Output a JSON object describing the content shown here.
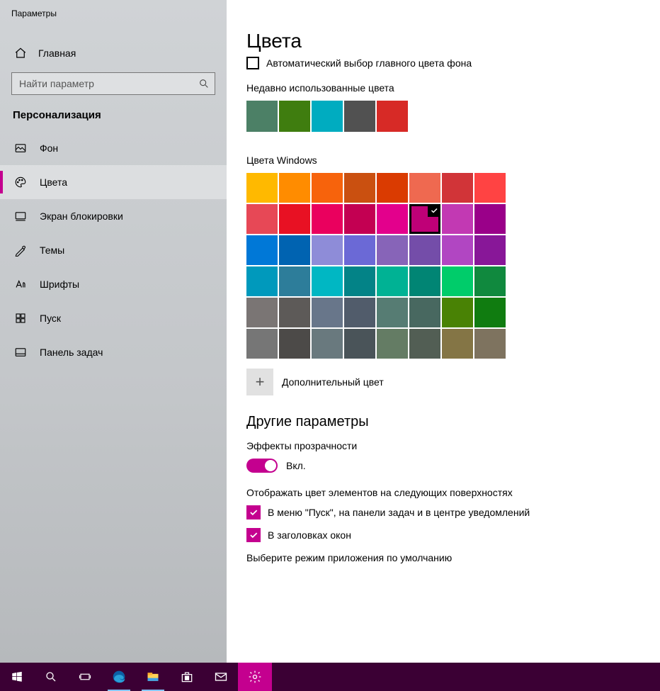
{
  "windowTitle": "Параметры",
  "sidebar": {
    "home": "Главная",
    "searchPlaceholder": "Найти параметр",
    "category": "Персонализация",
    "items": [
      {
        "key": "background",
        "label": "Фон"
      },
      {
        "key": "colors",
        "label": "Цвета"
      },
      {
        "key": "lockscreen",
        "label": "Экран блокировки"
      },
      {
        "key": "themes",
        "label": "Темы"
      },
      {
        "key": "fonts",
        "label": "Шрифты"
      },
      {
        "key": "start",
        "label": "Пуск"
      },
      {
        "key": "taskbar",
        "label": "Панель задач"
      }
    ],
    "activeKey": "colors"
  },
  "content": {
    "title": "Цвета",
    "autoPick": {
      "label": "Автоматический выбор главного цвета фона",
      "checked": false
    },
    "recent": {
      "label": "Недавно использованные цвета",
      "colors": [
        "#4c8066",
        "#3f7d0f",
        "#00acc0",
        "#515151",
        "#d72a26"
      ]
    },
    "windowsColors": {
      "label": "Цвета Windows",
      "colors": [
        "#ffb900",
        "#ff8c00",
        "#f7630c",
        "#ca5010",
        "#da3b01",
        "#ef6950",
        "#d13438",
        "#ff4343",
        "#e74856",
        "#e81123",
        "#ea005e",
        "#c30052",
        "#e3008c",
        "#bf0077",
        "#c239b3",
        "#9a0089",
        "#0078d7",
        "#0063b1",
        "#8e8cd8",
        "#6b69d6",
        "#8764b8",
        "#744da9",
        "#b146c2",
        "#881798",
        "#0099bc",
        "#2d7d9a",
        "#00b7c3",
        "#038387",
        "#00b294",
        "#018574",
        "#00cc6a",
        "#10893e",
        "#7a7574",
        "#5d5a58",
        "#68768a",
        "#515c6b",
        "#567c73",
        "#486860",
        "#498205",
        "#107c10",
        "#767676",
        "#4c4a48",
        "#69797e",
        "#4a5459",
        "#647c64",
        "#525e54",
        "#847545",
        "#7e735f"
      ],
      "selectedIndex": 13
    },
    "customColor": {
      "label": "Дополнительный цвет"
    },
    "otherParams": {
      "heading": "Другие параметры",
      "transparency": {
        "label": "Эффекты прозрачности",
        "state": "Вкл.",
        "on": true
      },
      "surfaces": {
        "label": "Отображать цвет элементов на следующих поверхностях",
        "options": [
          {
            "label": "В меню \"Пуск\", на панели задач и в центре уведомлений",
            "checked": true
          },
          {
            "label": "В заголовках окон",
            "checked": true
          }
        ]
      },
      "appMode": {
        "label": "Выберите режим приложения по умолчанию"
      }
    }
  },
  "accent": "#c4008f",
  "taskbar": {
    "items": [
      {
        "key": "start",
        "icon": "windows"
      },
      {
        "key": "search",
        "icon": "search"
      },
      {
        "key": "taskview",
        "icon": "taskview"
      },
      {
        "key": "edge",
        "icon": "edge",
        "open": true
      },
      {
        "key": "explorer",
        "icon": "explorer",
        "open": true
      },
      {
        "key": "store",
        "icon": "store"
      },
      {
        "key": "mail",
        "icon": "mail"
      },
      {
        "key": "settings",
        "icon": "gear",
        "active": true
      }
    ]
  }
}
